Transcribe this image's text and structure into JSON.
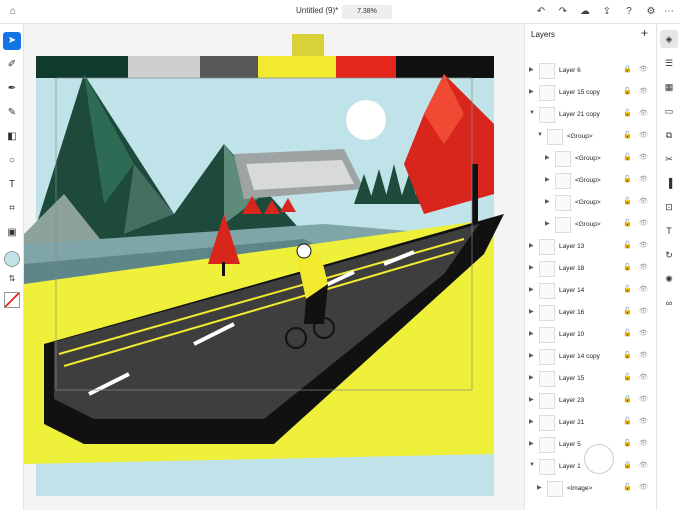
{
  "document": {
    "title": "Untitled (9)*",
    "zoom": "7.38%"
  },
  "colors": {
    "swatches": [
      "#0f3b2f",
      "#cfcfcf",
      "#575757",
      "#f2ea2e",
      "#e3271d",
      "#111111"
    ],
    "sky": "#bfe3e8",
    "ground": "#eef03a",
    "road": "#3e3e3e",
    "tree": "#d9261c"
  },
  "toolbar_icons": [
    "select-icon",
    "direct-select-icon",
    "pen-icon",
    "pencil-icon",
    "eraser-icon",
    "shape-icon",
    "text-icon",
    "crop-icon",
    "image-icon"
  ],
  "layers": {
    "title": "Layers",
    "items": [
      {
        "name": "Layer 6",
        "indent": 0,
        "locked": true
      },
      {
        "name": "Layer 15 copy",
        "indent": 0,
        "locked": false
      },
      {
        "name": "Layer 21 copy",
        "indent": 0,
        "locked": false,
        "expanded": true
      },
      {
        "name": "<Group>",
        "indent": 1,
        "locked": false,
        "expanded": true
      },
      {
        "name": "<Group>",
        "indent": 2,
        "locked": false
      },
      {
        "name": "<Group>",
        "indent": 2,
        "locked": false
      },
      {
        "name": "<Group>",
        "indent": 2,
        "locked": false
      },
      {
        "name": "<Group>",
        "indent": 2,
        "locked": false
      },
      {
        "name": "Layer 13",
        "indent": 0,
        "locked": false
      },
      {
        "name": "Layer 18",
        "indent": 0,
        "locked": false
      },
      {
        "name": "Layer 14",
        "indent": 0,
        "locked": false
      },
      {
        "name": "Layer 16",
        "indent": 0,
        "locked": false
      },
      {
        "name": "Layer 10",
        "indent": 0,
        "locked": false
      },
      {
        "name": "Layer 14 copy",
        "indent": 0,
        "locked": false
      },
      {
        "name": "Layer 15",
        "indent": 0,
        "locked": false
      },
      {
        "name": "Layer 23",
        "indent": 0,
        "locked": true
      },
      {
        "name": "Layer 21",
        "indent": 0,
        "locked": false
      },
      {
        "name": "Layer 5",
        "indent": 0,
        "locked": false
      },
      {
        "name": "Layer 1",
        "indent": 0,
        "locked": true,
        "expanded": true
      },
      {
        "name": "<image>",
        "indent": 1,
        "locked": false
      }
    ]
  }
}
